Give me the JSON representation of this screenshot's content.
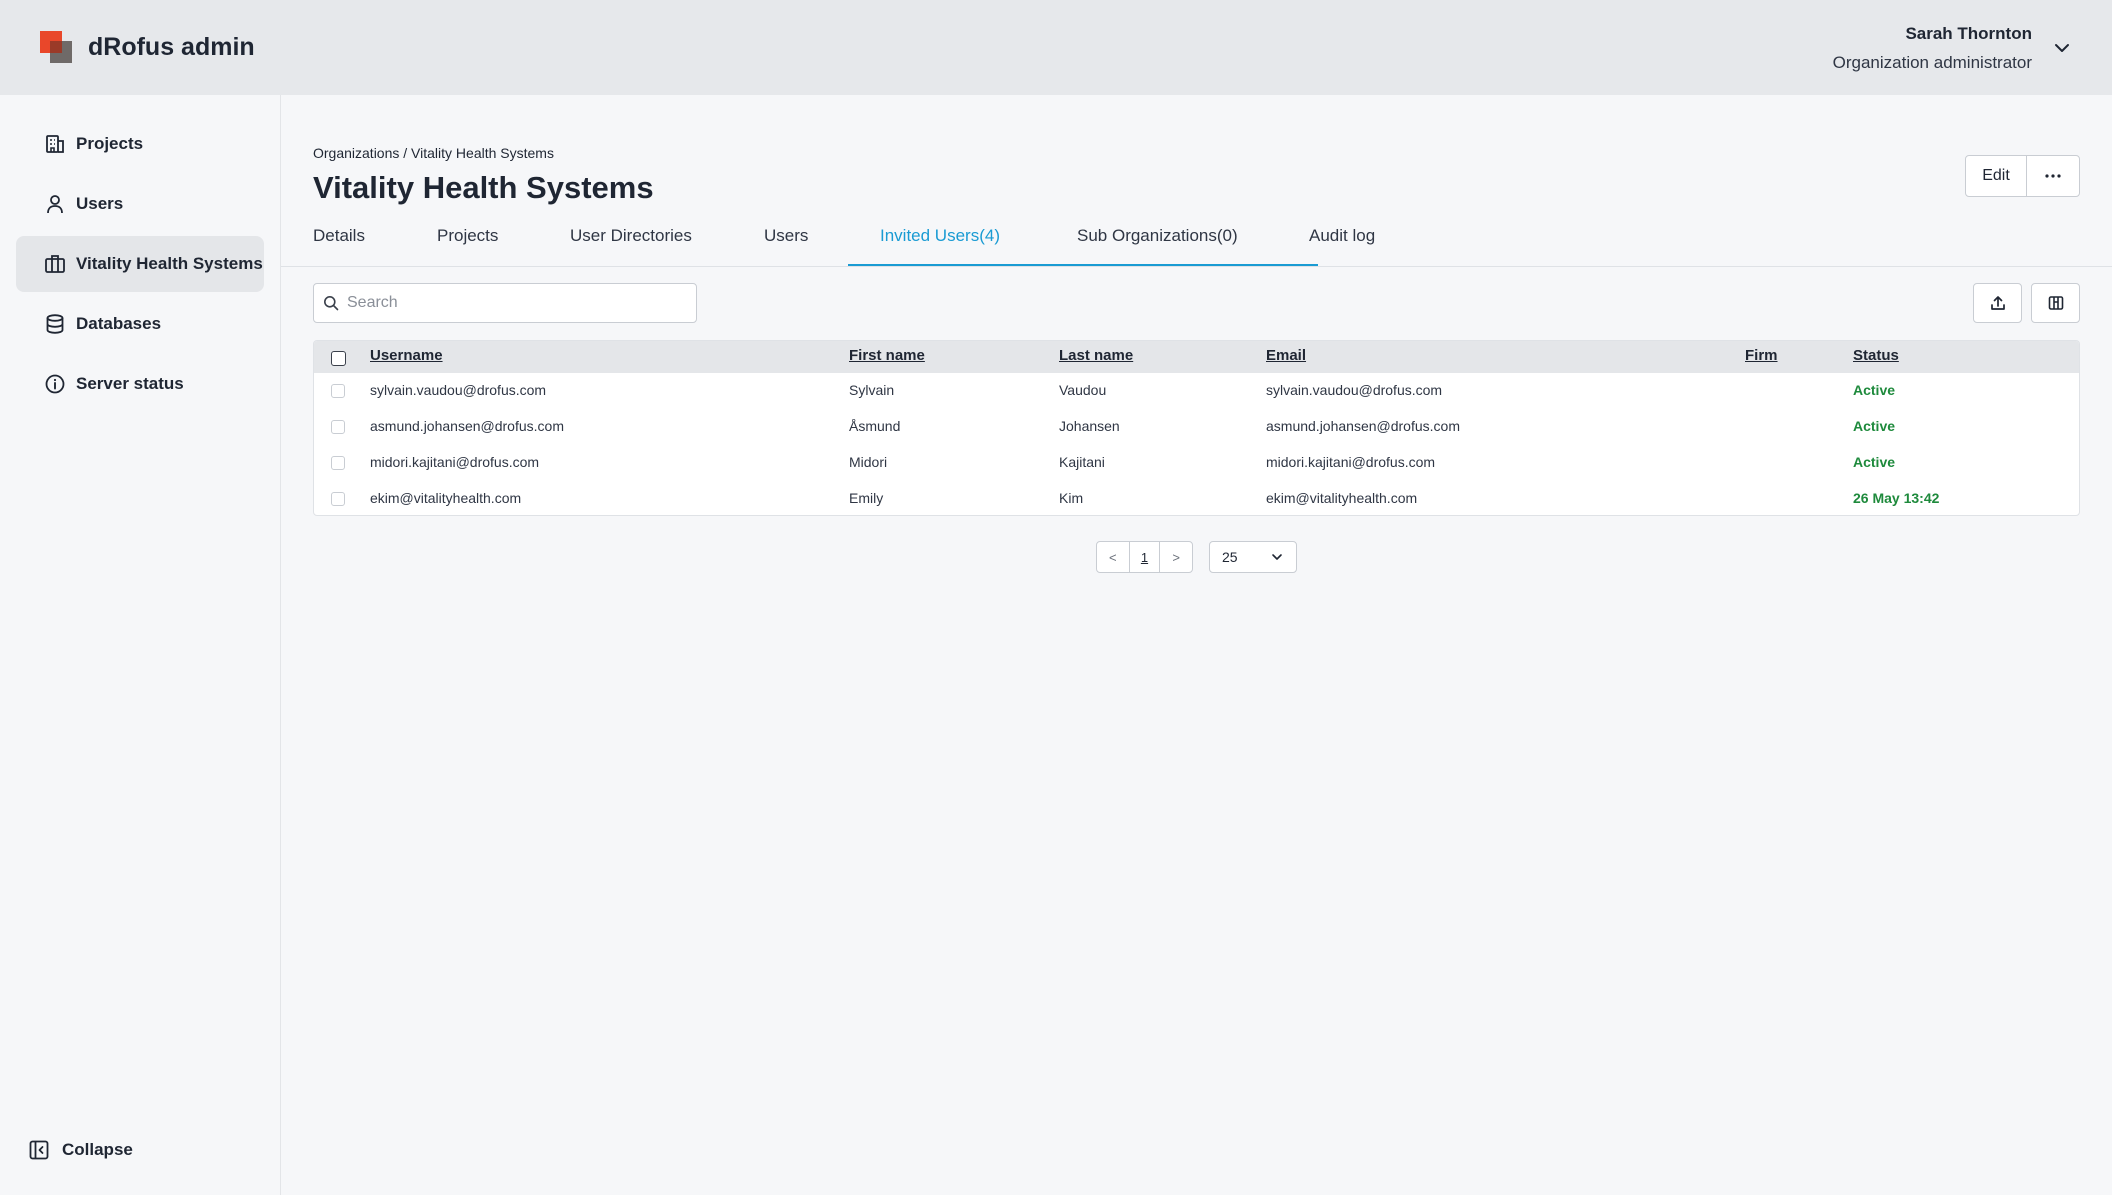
{
  "app": {
    "title": "dRofus admin"
  },
  "user": {
    "name": "Sarah Thornton",
    "role": "Organization administrator"
  },
  "sidebar": {
    "items": [
      {
        "label": "Projects",
        "icon": "building-icon"
      },
      {
        "label": "Users",
        "icon": "user-icon"
      },
      {
        "label": "Vitality Health Systems",
        "icon": "briefcase-icon",
        "active": true
      },
      {
        "label": "Databases",
        "icon": "database-icon"
      },
      {
        "label": "Server status",
        "icon": "info-icon"
      }
    ],
    "collapse_label": "Collapse"
  },
  "breadcrumb": "Organizations / Vitality Health Systems",
  "page_title": "Vitality Health Systems",
  "actions": {
    "edit_label": "Edit"
  },
  "tabs": [
    {
      "label": "Details"
    },
    {
      "label": "Projects"
    },
    {
      "label": "User Directories"
    },
    {
      "label": "Users"
    },
    {
      "label": "Invited Users(4)",
      "active": true
    },
    {
      "label": "Sub Organizations(0)"
    },
    {
      "label": "Audit log"
    }
  ],
  "search": {
    "placeholder": "Search",
    "value": ""
  },
  "table": {
    "columns": [
      "Username",
      "First name",
      "Last name",
      "Email",
      "Firm",
      "Status"
    ],
    "rows": [
      {
        "username": "sylvain.vaudou@drofus.com",
        "first": "Sylvain",
        "last": "Vaudou",
        "email": "sylvain.vaudou@drofus.com",
        "firm": "",
        "status": "Active"
      },
      {
        "username": "asmund.johansen@drofus.com",
        "first": "Åsmund",
        "last": "Johansen",
        "email": "asmund.johansen@drofus.com",
        "firm": "",
        "status": "Active"
      },
      {
        "username": "midori.kajitani@drofus.com",
        "first": "Midori",
        "last": "Kajitani",
        "email": "midori.kajitani@drofus.com",
        "firm": "",
        "status": "Active"
      },
      {
        "username": "ekim@vitalityhealth.com",
        "first": "Emily",
        "last": "Kim",
        "email": "ekim@vitalityhealth.com",
        "firm": "",
        "status": "26 May 13:42"
      }
    ]
  },
  "pagination": {
    "prev": "<",
    "current": "1",
    "next": ">",
    "page_size": "25"
  },
  "colors": {
    "accent": "#1a9bd3",
    "status_active": "#1e8a3c",
    "brand": "#e9472a"
  }
}
